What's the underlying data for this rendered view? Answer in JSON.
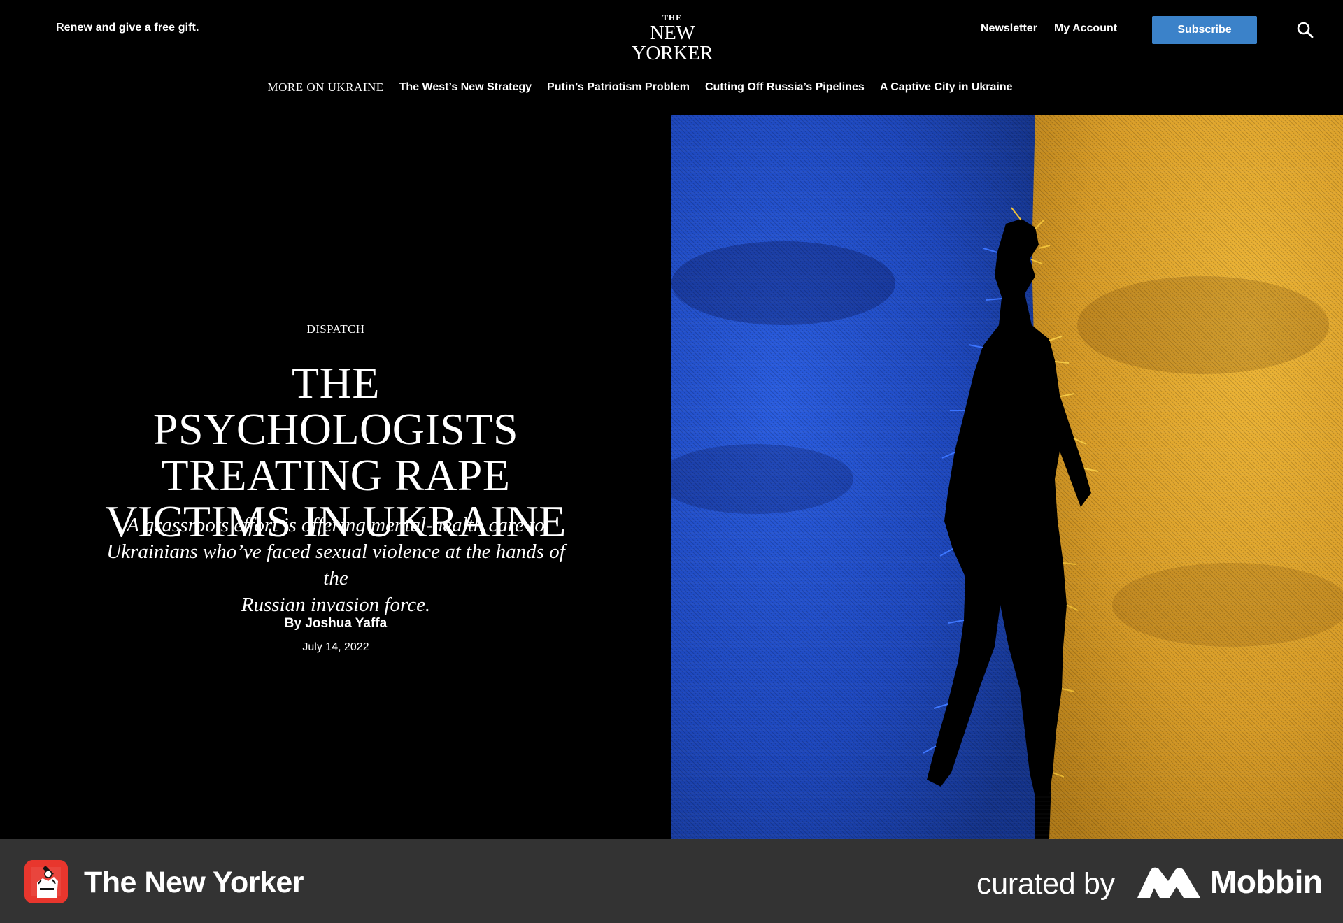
{
  "header": {
    "promo": "Renew and give a free gift.",
    "logo_top": "THE",
    "logo_name": "NEW YORKER",
    "newsletter": "Newsletter",
    "account": "My Account",
    "subscribe": "Subscribe",
    "search_icon": "search-icon"
  },
  "subnav": {
    "label": "More on Ukraine",
    "items": [
      "The West’s New Strategy",
      "Putin’s Patriotism Problem",
      "Cutting Off Russia’s Pipelines",
      "A Captive City in Ukraine"
    ]
  },
  "article": {
    "rubric": "Dispatch",
    "headline_lines": [
      "The Psychologists",
      "Treating Rape",
      "Victims in Ukraine"
    ],
    "dek_lines": [
      "A grassroots effort is offering mental-health care to",
      "Ukrainians who’ve faced sexual violence at the hands of the",
      "Russian invasion force."
    ],
    "byline_prefix": "By",
    "author": "Joshua Yaffa",
    "date": "July 14, 2022"
  },
  "hero_image": {
    "colors": {
      "blue": "#1f4fd0",
      "yellow": "#e3a72c",
      "figure": "#000000"
    }
  },
  "footer": {
    "app_name": "The New Yorker",
    "curated_by": "curated by",
    "brand": "Mobbin"
  }
}
